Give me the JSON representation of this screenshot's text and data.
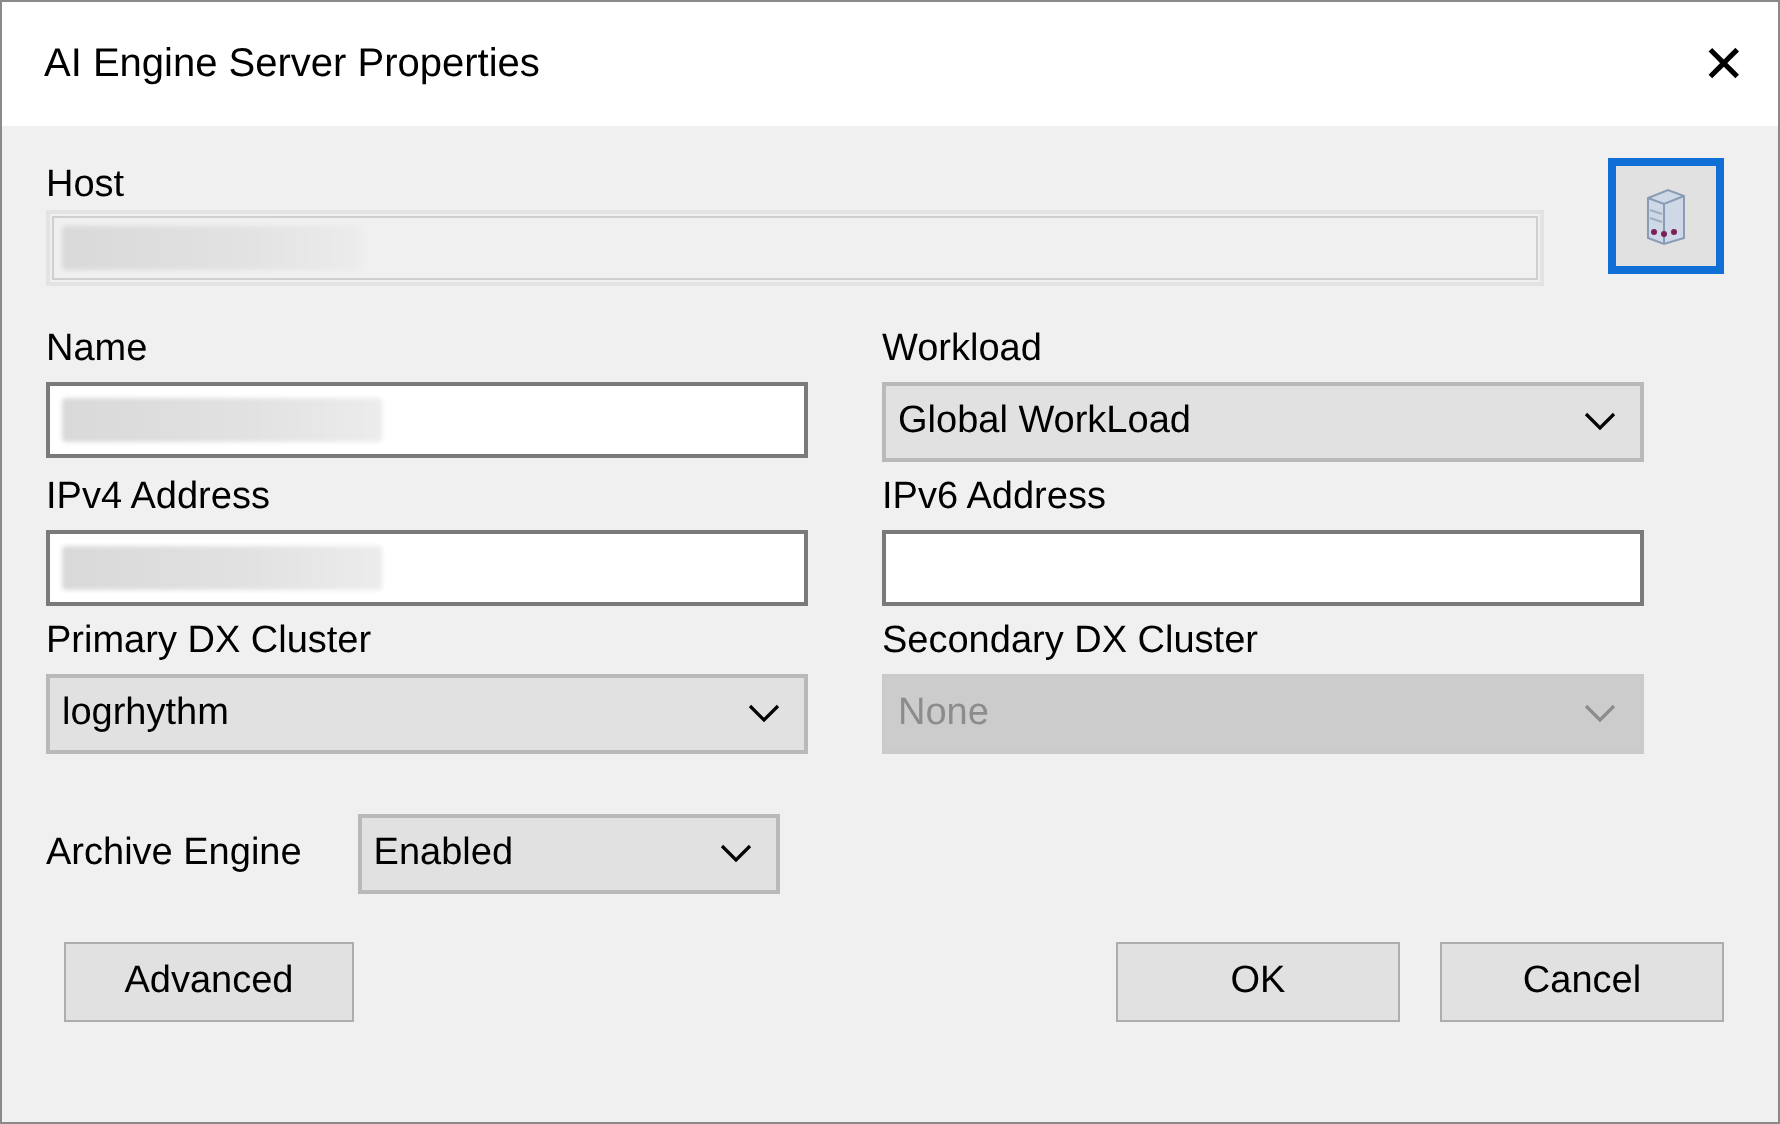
{
  "window": {
    "title": "AI Engine Server Properties",
    "close": "✕"
  },
  "host": {
    "label": "Host",
    "redacted": true,
    "disabled": true
  },
  "fields": [
    {
      "label": "Name",
      "kind": "text",
      "redacted": true,
      "disabled": false
    },
    {
      "label": "Workload",
      "kind": "select",
      "value": "Global WorkLoad",
      "disabled": false
    },
    {
      "label": "IPv4 Address",
      "kind": "text",
      "redacted": true,
      "disabled": false
    },
    {
      "label": "IPv6 Address",
      "kind": "text",
      "disabled": false
    },
    {
      "label": "Primary DX Cluster",
      "kind": "select",
      "value": "logrhythm",
      "disabled": false
    },
    {
      "label": "Secondary DX Cluster",
      "kind": "select",
      "value": "None",
      "disabled": true
    }
  ],
  "archive": {
    "label": "Archive Engine",
    "value": "Enabled"
  },
  "left_buttons": [
    "Advanced"
  ],
  "right_buttons": [
    "OK",
    "Cancel"
  ]
}
